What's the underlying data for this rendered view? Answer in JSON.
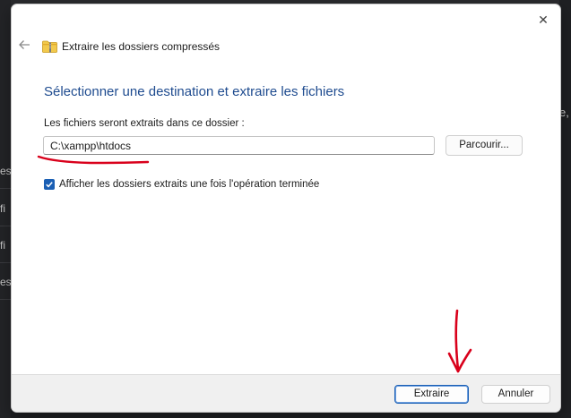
{
  "dialog": {
    "window_title": "Extraire les dossiers compressés",
    "heading": "Sélectionner une destination et extraire les fichiers",
    "destination_label": "Les fichiers seront extraits dans ce dossier :",
    "destination_path": "C:\\xampp\\htdocs",
    "browse_label": "Parcourir...",
    "show_checkbox_label": "Afficher les dossiers extraits une fois l'opération terminée",
    "show_checkbox_checked": true,
    "extract_label": "Extraire",
    "cancel_label": "Annuler",
    "close_icon": "close-icon",
    "back_icon": "back-arrow-icon",
    "folder_icon": "zip-folder-icon"
  },
  "background": {
    "left_fragments": [
      "es",
      "fi",
      "fi",
      "es"
    ],
    "right_fragment": "e,"
  },
  "colors": {
    "accent": "#1a5fb4",
    "heading": "#1e4b8f",
    "annotation": "#d9001b"
  }
}
